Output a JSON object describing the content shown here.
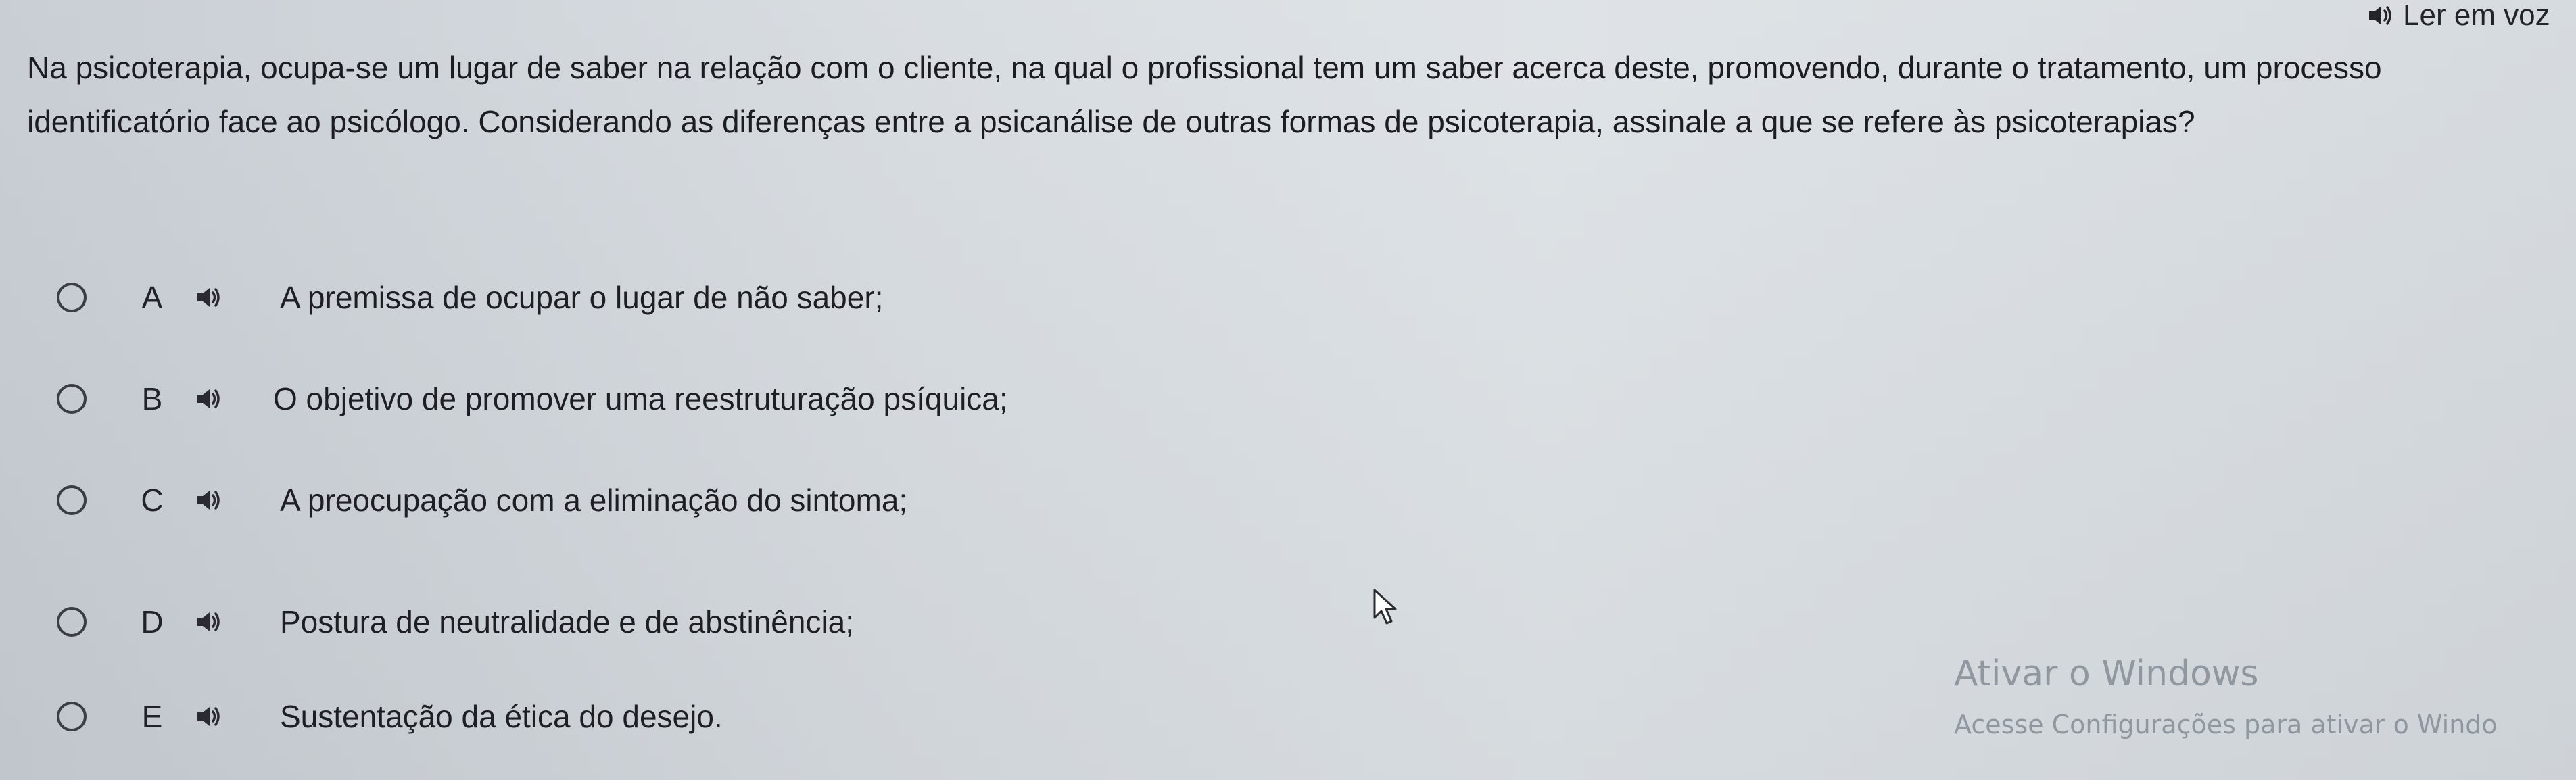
{
  "read_aloud": {
    "label": "Ler em voz",
    "icon": "speaker-icon"
  },
  "question": {
    "text": "Na psicoterapia, ocupa-se um lugar de saber na relação com o cliente, na qual o profissional tem um saber acerca deste, promovendo, durante o tratamento, um processo identificatório face ao psicólogo. Considerando as diferenças entre a psicanálise de outras formas de psicoterapia, assinale a que se refere às psicoterapias?"
  },
  "options": [
    {
      "letter": "A",
      "text": "A premissa de ocupar o lugar de não saber;"
    },
    {
      "letter": "B",
      "text": "O objetivo de promover uma reestruturação psíquica;"
    },
    {
      "letter": "C",
      "text": "A preocupação com a eliminação do sintoma;"
    },
    {
      "letter": "D",
      "text": "Postura de neutralidade e de abstinência;"
    },
    {
      "letter": "E",
      "text": "Sustentação da ética do desejo."
    }
  ],
  "watermark": {
    "title": "Ativar o Windows",
    "subtitle": "Acesse Configurações para ativar o Windo"
  },
  "colors": {
    "text": "#1c1d22",
    "radio_border": "#3a3d44",
    "watermark": "#767e88"
  }
}
